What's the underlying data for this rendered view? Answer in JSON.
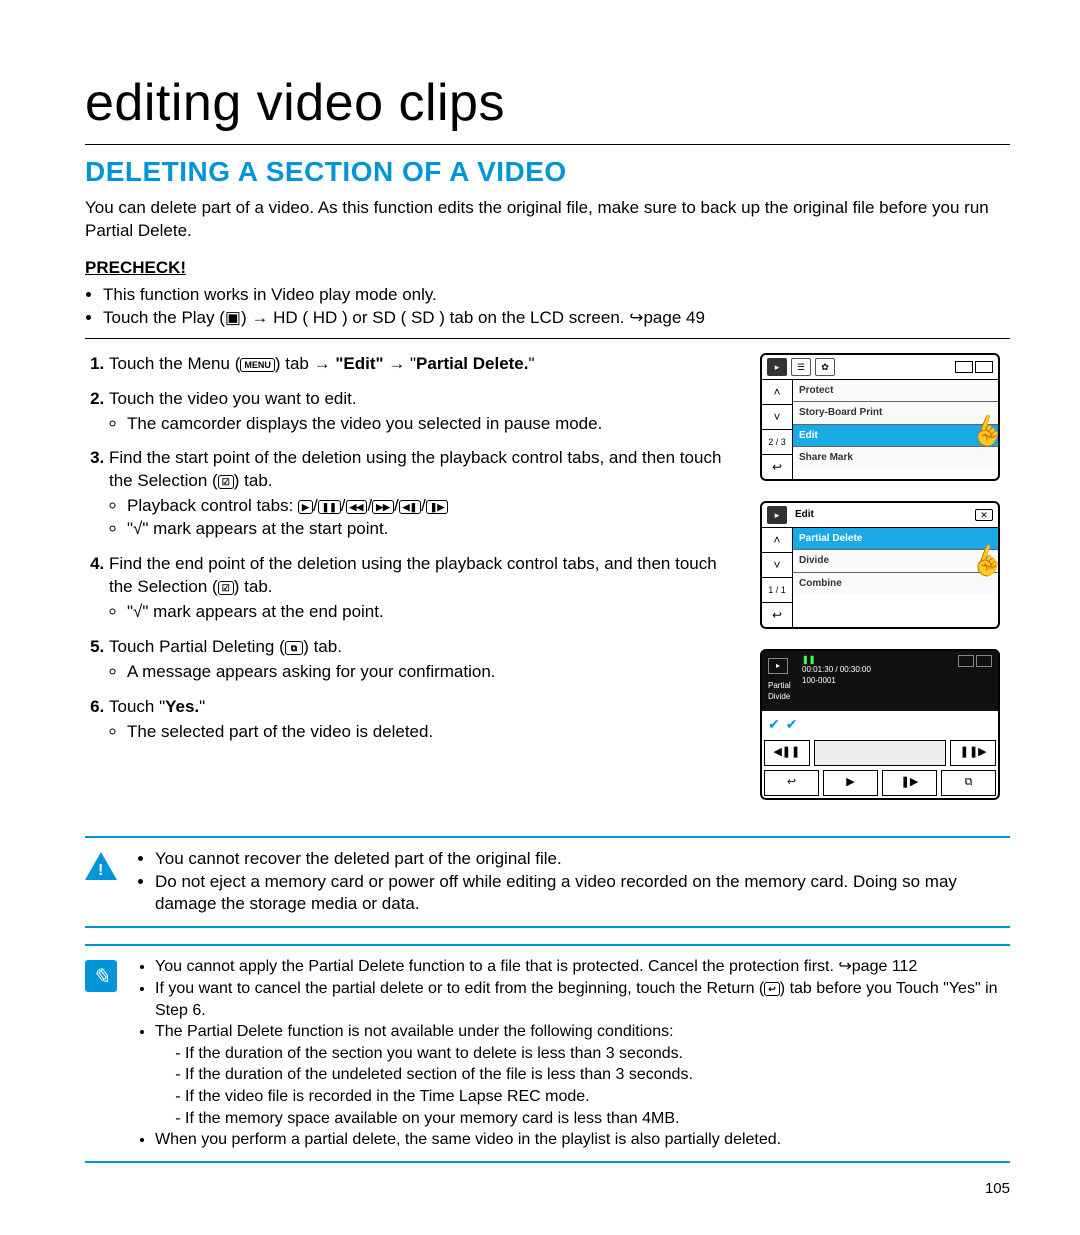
{
  "chapterTitle": "editing video clips",
  "heading": "DELETING A SECTION OF A VIDEO",
  "intro": "You can delete part of a video. As this function edits the original file, make sure to back up the original file before you run Partial Delete.",
  "precheckLabel": "PRECHECK!",
  "precheck": [
    "This function works in Video play mode only.",
    "Touch the Play (▣) → HD ( HD ) or SD ( SD ) tab on the LCD screen. ↪page 49"
  ],
  "steps": {
    "s1a": "Touch the Menu (",
    "s1key": "MENU",
    "s1b": ") tab → ",
    "s1c": "\"Edit\"",
    "s1d": " → \"",
    "s1e": "Partial Delete.",
    "s1f": "\"",
    "s2": "Touch the video you want to edit.",
    "s2a": "The camcorder displays the video you selected in pause mode.",
    "s3a": "Find the start point of the deletion using the playback control tabs, and then touch the Selection (",
    "s3key": "☑",
    "s3b": ") tab.",
    "s3c": "Playback control tabs: ",
    "s3d": "\"√\" mark appears at the start point.",
    "s4a": "Find the end point of the deletion using the playback control tabs, and then touch the Selection (",
    "s4b": ") tab.",
    "s4c": "\"√\" mark appears at the end point.",
    "s5a": "Touch Partial Deleting (",
    "s5key": "⧉",
    "s5b": ") tab.",
    "s5c": "A message appears asking for your confirmation.",
    "s6a": "Touch \"",
    "s6b": "Yes.",
    "s6c": "\"",
    "s6d": "The selected part of the video is deleted."
  },
  "playbackKeys": [
    "▶",
    "❚❚",
    "◀◀",
    "▶▶",
    "◀❚",
    "❚▶"
  ],
  "warn": [
    "You cannot recover the deleted part of the original file.",
    "Do not eject a memory card or power off while editing a video recorded on the memory card. Doing so may damage the storage media or data."
  ],
  "notes": {
    "n1": "You cannot apply the Partial Delete function to a file that is protected. Cancel the protection first. ↪page 112",
    "n2a": "If you want to cancel the partial delete or to edit from the beginning, touch the Return (",
    "n2key": "↩",
    "n2b": ") tab before you Touch \"Yes\" in Step 6.",
    "n3": "The Partial Delete function is not available under the following conditions:",
    "n3a": "If the duration of the section you want to delete is less than 3 seconds.",
    "n3b": "If the duration of the undeleted section of the file is less than 3 seconds.",
    "n3c": "If the video file is recorded in the Time Lapse REC mode.",
    "n3d": "If the memory space available on your memory card is less than 4MB.",
    "n4": "When you perform a partial delete, the same video in the playlist is also partially deleted."
  },
  "screens": {
    "s1": {
      "pager": "2 / 3",
      "items": [
        "Protect",
        "Story-Board Print",
        "Edit",
        "Share Mark"
      ],
      "selected": 2
    },
    "s2": {
      "title": "Edit",
      "pager": "1 / 1",
      "items": [
        "Partial Delete",
        "Divide",
        "Combine"
      ],
      "selected": 0
    },
    "s3": {
      "time": "00:01:30 / 00:30:00",
      "file": "100-0001",
      "mode": "Partial Divide"
    }
  },
  "pageNumber": "105"
}
